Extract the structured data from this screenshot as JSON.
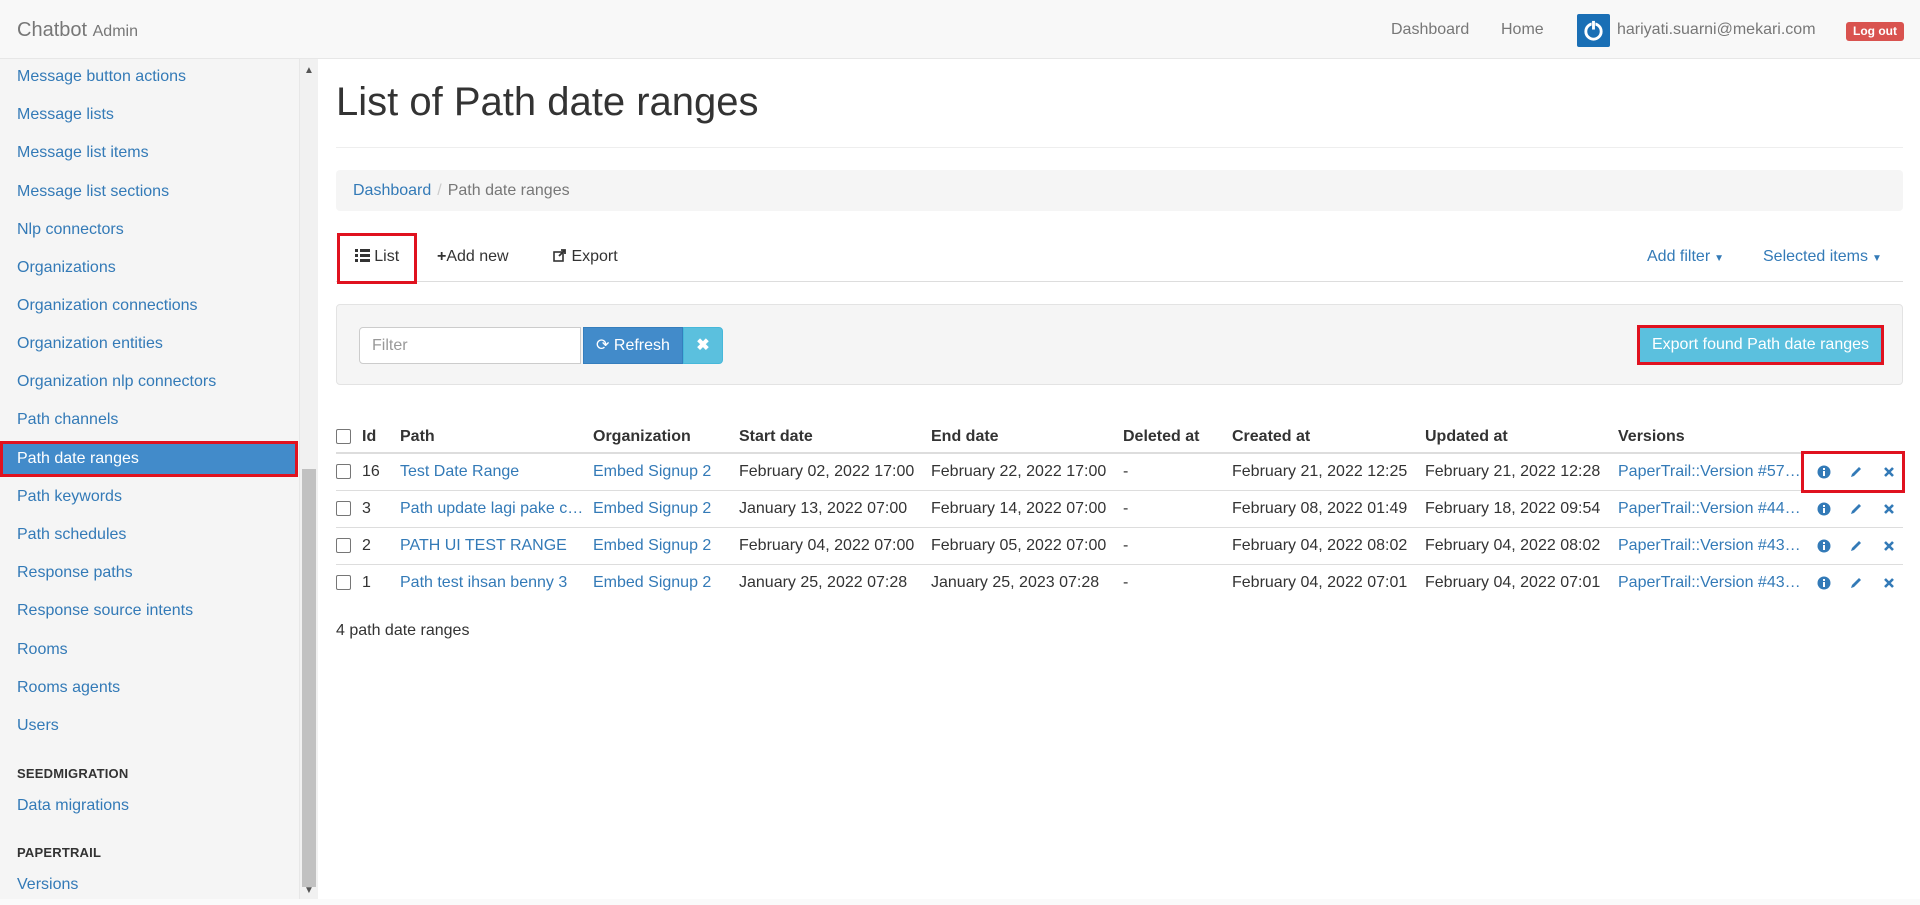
{
  "navbar": {
    "brand": "Chatbot",
    "brand_small": "Admin",
    "links": {
      "dashboard": "Dashboard",
      "home": "Home"
    },
    "user_email": "hariyati.suarni@mekari.com",
    "logout": "Log out"
  },
  "sidebar": {
    "items": [
      "Message button actions",
      "Message lists",
      "Message list items",
      "Message list sections",
      "Nlp connectors",
      "Organizations",
      "Organization connections",
      "Organization entities",
      "Organization nlp connectors",
      "Path channels",
      "Path date ranges",
      "Path keywords",
      "Path schedules",
      "Response paths",
      "Response source intents",
      "Rooms",
      "Rooms agents",
      "Users"
    ],
    "active_item": "Path date ranges",
    "section_seed": "SEEDMIGRATION",
    "seed_items": [
      "Data migrations"
    ],
    "section_paper": "PAPERTRAIL",
    "paper_items": [
      "Versions"
    ]
  },
  "main": {
    "title": "List of Path date ranges",
    "breadcrumb": {
      "root": "Dashboard",
      "current": "Path date ranges"
    },
    "tabs": {
      "list": "List",
      "add_new": "Add new",
      "export": "Export",
      "add_filter": "Add filter",
      "selected_items": "Selected items"
    },
    "filter": {
      "placeholder": "Filter",
      "value": "",
      "refresh": "Refresh",
      "export_found": "Export found Path date ranges"
    },
    "table": {
      "headers": [
        "Id",
        "Path",
        "Organization",
        "Start date",
        "End date",
        "Deleted at",
        "Created at",
        "Updated at",
        "Versions"
      ],
      "rows": [
        {
          "id": "16",
          "path": "Test Date Range",
          "organization": "Embed Signup 2",
          "start": "February 02, 2022 17:00",
          "end": "February 22, 2022 17:00",
          "deleted": "-",
          "created": "February 21, 2022 12:25",
          "updated": "February 21, 2022 12:28",
          "versions": "PaperTrail::Version #57…"
        },
        {
          "id": "3",
          "path": "Path update lagi pake c…",
          "organization": "Embed Signup 2",
          "start": "January 13, 2022 07:00",
          "end": "February 14, 2022 07:00",
          "deleted": "-",
          "created": "February 08, 2022 01:49",
          "updated": "February 18, 2022 09:54",
          "versions": "PaperTrail::Version #44…"
        },
        {
          "id": "2",
          "path": "PATH UI TEST RANGE",
          "organization": "Embed Signup 2",
          "start": "February 04, 2022 07:00",
          "end": "February 05, 2022 07:00",
          "deleted": "-",
          "created": "February 04, 2022 08:02",
          "updated": "February 04, 2022 08:02",
          "versions": "PaperTrail::Version #43…"
        },
        {
          "id": "1",
          "path": "Path test ihsan benny 3",
          "organization": "Embed Signup 2",
          "start": "January 25, 2022 07:28",
          "end": "January 25, 2023 07:28",
          "deleted": "-",
          "created": "February 04, 2022 07:01",
          "updated": "February 04, 2022 07:01",
          "versions": "PaperTrail::Version #43…"
        }
      ]
    },
    "count": "4 path date ranges"
  },
  "colors": {
    "link": "#337ab7",
    "active": "#428bca",
    "info": "#5bc0de",
    "danger": "#d9534f",
    "highlight": "#e0121f"
  },
  "icons": [
    "power-icon",
    "list-icon",
    "plus-icon",
    "export-icon",
    "refresh-icon",
    "times-icon",
    "info-icon",
    "pencil-icon",
    "delete-icon"
  ]
}
